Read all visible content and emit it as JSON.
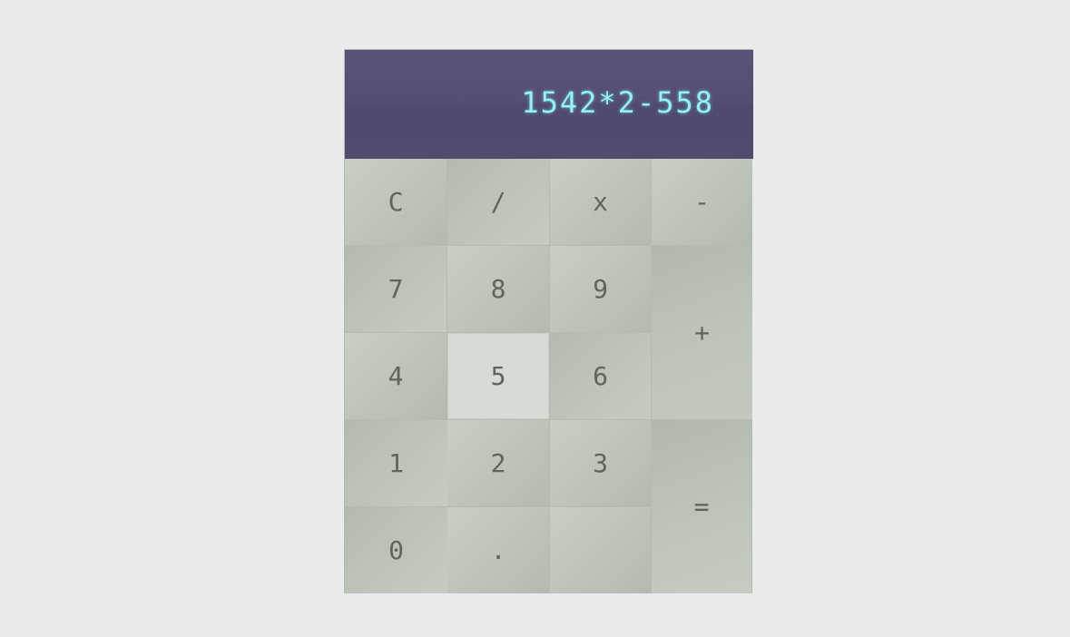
{
  "display": {
    "expression": "1542*2-558"
  },
  "keys": {
    "clear": "C",
    "divide": "/",
    "multiply": "x",
    "minus": "-",
    "seven": "7",
    "eight": "8",
    "nine": "9",
    "plus": "+",
    "four": "4",
    "five": "5",
    "six": "6",
    "one": "1",
    "two": "2",
    "three": "3",
    "equals": "=",
    "zero": "0",
    "decimal": "."
  },
  "colors": {
    "display_background": "#554e74",
    "display_text": "#8ff2f5",
    "key_background": "#bec5ba",
    "key_pressed": "#d6dbd3",
    "key_text": "#5f655d",
    "page_background": "#ebebeb"
  }
}
